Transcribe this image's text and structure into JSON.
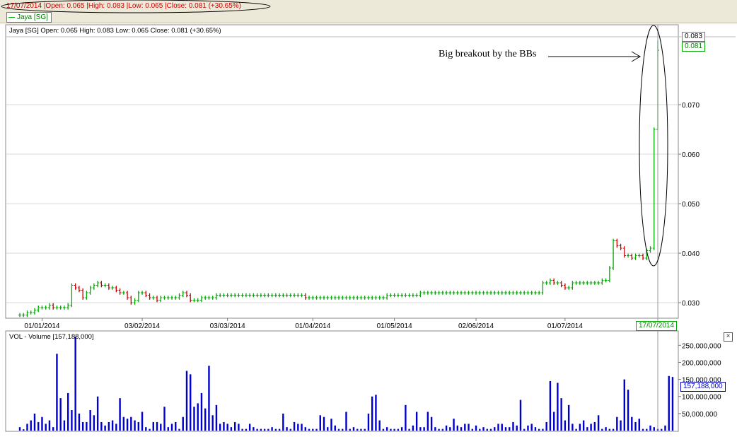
{
  "header": {
    "info_line": "17/07/2014 |Open: 0.065 |High: 0.083 |Low: 0.065 |Close: 0.081 (+30.65%)",
    "legend_label": "Jaya [SG]"
  },
  "price_pane": {
    "title": "Jaya [SG] Open: 0.065  High: 0.083  Low: 0.065  Close: 0.081 (+30.65%)",
    "high_tag": "0.083",
    "close_tag": "0.081",
    "date_tag": "17/07/2014"
  },
  "volume_pane": {
    "title": "VOL - Volume [157,188,000]",
    "last_tag": "157,188,000",
    "close_symbol": "×"
  },
  "annotation": {
    "text": "Big breakout by the BBs"
  },
  "colors": {
    "up": "#00aa00",
    "down": "#cc0000",
    "volume": "#0000cc",
    "grid": "#d8d8d8",
    "info_text": "#cc0000"
  },
  "chart_data": [
    {
      "type": "ohlc",
      "title": "Jaya [SG]",
      "ylim": [
        0.027,
        0.086
      ],
      "y_ticks": [
        "0.030",
        "0.040",
        "0.050",
        "0.060",
        "0.070"
      ],
      "x_tick_labels": [
        "01/01/2014",
        "03/02/2014",
        "03/03/2014",
        "01/04/2014",
        "01/05/2014",
        "02/06/2014",
        "01/07/2014"
      ],
      "last_bar": {
        "date": "17/07/2014",
        "open": 0.065,
        "high": 0.083,
        "low": 0.065,
        "close": 0.081,
        "change_pct": 30.65
      },
      "close": [
        0.0275,
        0.0275,
        0.028,
        0.028,
        0.0285,
        0.029,
        0.029,
        0.029,
        0.0295,
        0.029,
        0.029,
        0.029,
        0.029,
        0.0295,
        0.0335,
        0.033,
        0.0325,
        0.031,
        0.032,
        0.033,
        0.0335,
        0.034,
        0.0335,
        0.0335,
        0.033,
        0.033,
        0.0325,
        0.032,
        0.032,
        0.031,
        0.03,
        0.0305,
        0.032,
        0.032,
        0.0315,
        0.031,
        0.031,
        0.0305,
        0.031,
        0.031,
        0.031,
        0.031,
        0.031,
        0.0315,
        0.032,
        0.0315,
        0.0305,
        0.0305,
        0.0305,
        0.031,
        0.031,
        0.031,
        0.031,
        0.0315,
        0.0315,
        0.0315,
        0.0315,
        0.0315,
        0.0315,
        0.0315,
        0.0315,
        0.0315,
        0.0315,
        0.0315,
        0.0315,
        0.0315,
        0.0315,
        0.0315,
        0.0315,
        0.0315,
        0.0315,
        0.0315,
        0.0315,
        0.0315,
        0.0315,
        0.0315,
        0.0315,
        0.031,
        0.031,
        0.031,
        0.031,
        0.031,
        0.031,
        0.031,
        0.031,
        0.031,
        0.031,
        0.031,
        0.031,
        0.031,
        0.031,
        0.031,
        0.031,
        0.031,
        0.031,
        0.031,
        0.031,
        0.031,
        0.031,
        0.0315,
        0.0315,
        0.0315,
        0.0315,
        0.0315,
        0.0315,
        0.0315,
        0.0315,
        0.0315,
        0.032,
        0.032,
        0.032,
        0.032,
        0.032,
        0.032,
        0.032,
        0.032,
        0.032,
        0.032,
        0.032,
        0.032,
        0.032,
        0.032,
        0.032,
        0.032,
        0.032,
        0.032,
        0.032,
        0.032,
        0.032,
        0.032,
        0.032,
        0.032,
        0.032,
        0.032,
        0.032,
        0.032,
        0.032,
        0.032,
        0.032,
        0.032,
        0.032,
        0.034,
        0.034,
        0.0345,
        0.034,
        0.034,
        0.0335,
        0.033,
        0.033,
        0.034,
        0.034,
        0.034,
        0.034,
        0.034,
        0.034,
        0.034,
        0.034,
        0.0345,
        0.0345,
        0.037,
        0.0425,
        0.0415,
        0.041,
        0.0395,
        0.0395,
        0.039,
        0.0395,
        0.0395,
        0.039,
        0.0405,
        0.041,
        0.065,
        0.081
      ],
      "volume": [
        10000000,
        4000000,
        20000000,
        30000000,
        50000000,
        25000000,
        40000000,
        20000000,
        30000000,
        10000000,
        225000000,
        95000000,
        30000000,
        110000000,
        60000000,
        275000000,
        50000000,
        25000000,
        25000000,
        60000000,
        45000000,
        100000000,
        25000000,
        15000000,
        25000000,
        30000000,
        20000000,
        95000000,
        40000000,
        35000000,
        40000000,
        30000000,
        25000000,
        55000000,
        10000000,
        5000000,
        25000000,
        25000000,
        20000000,
        70000000,
        10000000,
        20000000,
        25000000,
        5000000,
        40000000,
        175000000,
        165000000,
        70000000,
        80000000,
        110000000,
        65000000,
        190000000,
        45000000,
        75000000,
        20000000,
        25000000,
        20000000,
        10000000,
        25000000,
        20000000,
        5000000,
        5000000,
        20000000,
        10000000,
        5000000,
        5000000,
        5000000,
        5000000,
        10000000,
        5000000,
        5000000,
        50000000,
        10000000,
        5000000,
        25000000,
        20000000,
        20000000,
        10000000,
        5000000,
        5000000,
        5000000,
        45000000,
        40000000,
        10000000,
        35000000,
        15000000,
        5000000,
        5000000,
        55000000,
        5000000,
        10000000,
        5000000,
        5000000,
        5000000,
        50000000,
        100000000,
        105000000,
        30000000,
        5000000,
        10000000,
        5000000,
        5000000,
        5000000,
        10000000,
        75000000,
        5000000,
        15000000,
        55000000,
        10000000,
        10000000,
        55000000,
        40000000,
        10000000,
        5000000,
        5000000,
        15000000,
        10000000,
        35000000,
        15000000,
        10000000,
        20000000,
        20000000,
        5000000,
        15000000,
        5000000,
        10000000,
        5000000,
        5000000,
        10000000,
        20000000,
        20000000,
        10000000,
        10000000,
        25000000,
        15000000,
        90000000,
        5000000,
        15000000,
        20000000,
        10000000,
        5000000,
        5000000,
        25000000,
        145000000,
        55000000,
        140000000,
        95000000,
        30000000,
        75000000,
        20000000,
        5000000,
        20000000,
        30000000,
        10000000,
        20000000,
        25000000,
        45000000,
        5000000,
        10000000,
        5000000,
        5000000,
        40000000,
        30000000,
        150000000,
        120000000,
        40000000,
        25000000,
        35000000,
        5000000,
        5000000,
        15000000,
        10000000,
        5000000,
        5000000,
        15000000,
        160000000,
        157188000
      ]
    },
    {
      "type": "bar",
      "title": "VOL - Volume",
      "ylim": [
        0,
        290000000
      ],
      "y_ticks": [
        "50,000,000",
        "100,000,000",
        "150,000,000",
        "200,000,000",
        "250,000,000"
      ]
    }
  ]
}
